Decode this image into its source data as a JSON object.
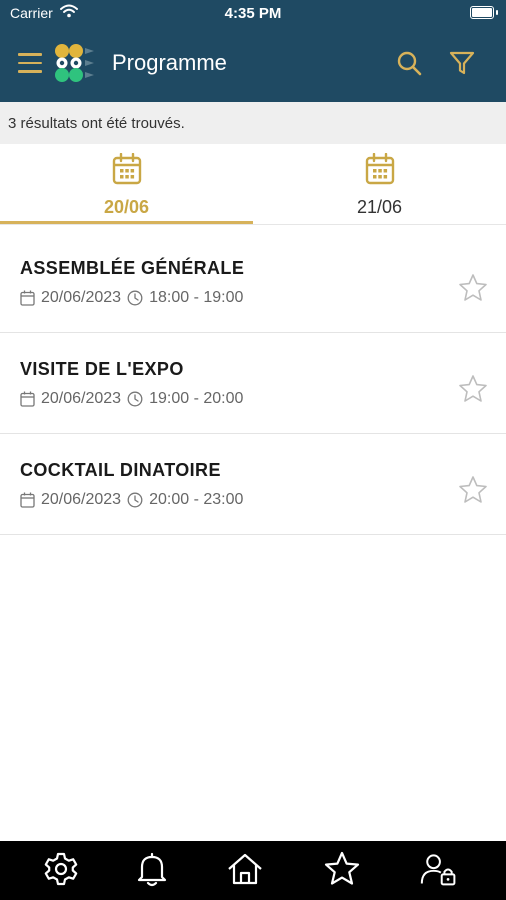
{
  "status_bar": {
    "carrier": "Carrier",
    "time": "4:35 PM"
  },
  "header": {
    "title": "Programme"
  },
  "results_text": "3 résultats ont été trouvés.",
  "tabs": [
    {
      "label": "20/06",
      "active": true
    },
    {
      "label": "21/06",
      "active": false
    }
  ],
  "sessions": [
    {
      "title": "ASSEMBLÉE GÉNÉRALE",
      "date": "20/06/2023",
      "time": "18:00 - 19:00"
    },
    {
      "title": "VISITE DE L'EXPO",
      "date": "20/06/2023",
      "time": "19:00 - 20:00"
    },
    {
      "title": "COCKTAIL DINATOIRE",
      "date": "20/06/2023",
      "time": "20:00 - 23:00"
    }
  ],
  "colors": {
    "header_bg": "#1f4a63",
    "accent": "#d7b25a",
    "active_tab": "#c9a745",
    "logo_yellow": "#e1b53c",
    "logo_green": "#2fc37e"
  },
  "icons": {
    "bottom_nav": [
      "gear-icon",
      "bell-icon",
      "home-icon",
      "star-icon",
      "user-lock-icon"
    ]
  }
}
